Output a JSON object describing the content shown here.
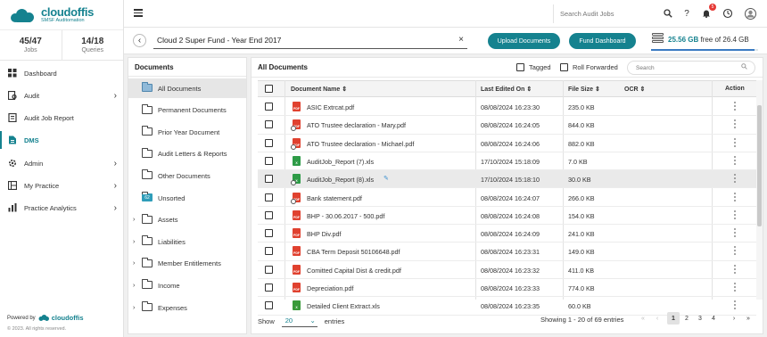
{
  "brand": {
    "name": "cloudoffis",
    "tagline": "SMSF Auditomation"
  },
  "stats": [
    {
      "value": "45/47",
      "label": "Jobs"
    },
    {
      "value": "14/18",
      "label": "Queries"
    }
  ],
  "nav": [
    {
      "label": "Dashboard",
      "icon": "dashboard-icon",
      "chevron": false
    },
    {
      "label": "Audit",
      "icon": "audit-icon",
      "chevron": true
    },
    {
      "label": "Audit Job Report",
      "icon": "report-icon",
      "chevron": false
    },
    {
      "label": "DMS",
      "icon": "dms-icon",
      "chevron": false
    },
    {
      "label": "Admin",
      "icon": "admin-icon",
      "chevron": true
    },
    {
      "label": "My Practice",
      "icon": "practice-icon",
      "chevron": true
    },
    {
      "label": "Practice Analytics",
      "icon": "analytics-icon",
      "chevron": true
    }
  ],
  "footer": {
    "powered_by": "Powered by",
    "brand": "cloudoffis",
    "copyright": "© 2023. All rights reserved."
  },
  "header": {
    "search_placeholder": "Search Audit Jobs",
    "notification_count": "5"
  },
  "context": {
    "job": "Cloud 2 Super Fund - Year End 2017",
    "upload_label": "Upload Documents",
    "dashboard_label": "Fund Dashboard",
    "storage_used": "25.56 GB",
    "storage_rest": " free of 26.4 GB",
    "storage_fraction": 0.968
  },
  "folders_panel": {
    "title": "Documents",
    "items": [
      {
        "label": "All Documents",
        "type": "open",
        "expandable": false,
        "active": true
      },
      {
        "label": "Permanent Documents",
        "type": "folder",
        "expandable": false
      },
      {
        "label": "Prior Year Document",
        "type": "folder",
        "expandable": false
      },
      {
        "label": "Audit Letters & Reports",
        "type": "folder",
        "expandable": false
      },
      {
        "label": "Other Documents",
        "type": "folder",
        "expandable": false
      },
      {
        "label": "Unsorted",
        "type": "count",
        "count": "62",
        "expandable": false
      },
      {
        "label": "Assets",
        "type": "folder",
        "expandable": true
      },
      {
        "label": "Liabilities",
        "type": "folder",
        "expandable": true
      },
      {
        "label": "Member Entitlements",
        "type": "folder",
        "expandable": true
      },
      {
        "label": "Income",
        "type": "folder",
        "expandable": true
      },
      {
        "label": "Expenses",
        "type": "folder",
        "expandable": true
      }
    ]
  },
  "table": {
    "title": "All Documents",
    "tagged_label": "Tagged",
    "roll_label": "Roll Forwarded",
    "search_placeholder": "Search",
    "columns": {
      "name": "Document Name",
      "edited": "Last Edited On",
      "size": "File Size",
      "ocr": "OCR",
      "action": "Action"
    },
    "rows": [
      {
        "name": "ASIC Extrcat.pdf",
        "edited": "08/08/2024 16:23:30",
        "size": "235.0 KB",
        "type": "pdf",
        "linked": false
      },
      {
        "name": "ATO Trustee declaration - Mary.pdf",
        "edited": "08/08/2024 16:24:05",
        "size": "844.0 KB",
        "type": "pdf",
        "linked": true
      },
      {
        "name": "ATO Trustee declaration - Michael.pdf",
        "edited": "08/08/2024 16:24:06",
        "size": "882.0 KB",
        "type": "pdf",
        "linked": true
      },
      {
        "name": "AuditJob_Report (7).xls",
        "edited": "17/10/2024 15:18:09",
        "size": "7.0 KB",
        "type": "xls",
        "linked": false
      },
      {
        "name": "AuditJob_Report (8).xls",
        "edited": "17/10/2024 15:18:10",
        "size": "30.0 KB",
        "type": "xls",
        "linked": true,
        "highlight": true,
        "editable": true
      },
      {
        "name": "Bank statement.pdf",
        "edited": "08/08/2024 16:24:07",
        "size": "266.0 KB",
        "type": "pdf",
        "linked": true
      },
      {
        "name": "BHP - 30.06.2017 - 500.pdf",
        "edited": "08/08/2024 16:24:08",
        "size": "154.0 KB",
        "type": "pdf",
        "linked": false
      },
      {
        "name": "BHP Div.pdf",
        "edited": "08/08/2024 16:24:09",
        "size": "241.0 KB",
        "type": "pdf",
        "linked": false
      },
      {
        "name": "CBA Term Deposit 50106648.pdf",
        "edited": "08/08/2024 16:23:31",
        "size": "149.0 KB",
        "type": "pdf",
        "linked": false
      },
      {
        "name": "Comitted Capital Dist & credit.pdf",
        "edited": "08/08/2024 16:23:32",
        "size": "411.0 KB",
        "type": "pdf",
        "linked": false
      },
      {
        "name": "Depreciation.pdf",
        "edited": "08/08/2024 16:23:33",
        "size": "774.0 KB",
        "type": "pdf",
        "linked": false
      },
      {
        "name": "Detailed Client Extract.xls",
        "edited": "08/08/2024 16:23:35",
        "size": "60.0 KB",
        "type": "csv",
        "linked": false
      }
    ],
    "show_label": "Show",
    "page_size": "20",
    "entries_label": "entries",
    "paging_info": "Showing  1 - 20 of 69 entries",
    "pages": [
      "1",
      "2",
      "3",
      "4"
    ]
  },
  "colors": {
    "accent": "#15828f",
    "pdf": "#e0412f",
    "xls": "#2e9b47"
  }
}
